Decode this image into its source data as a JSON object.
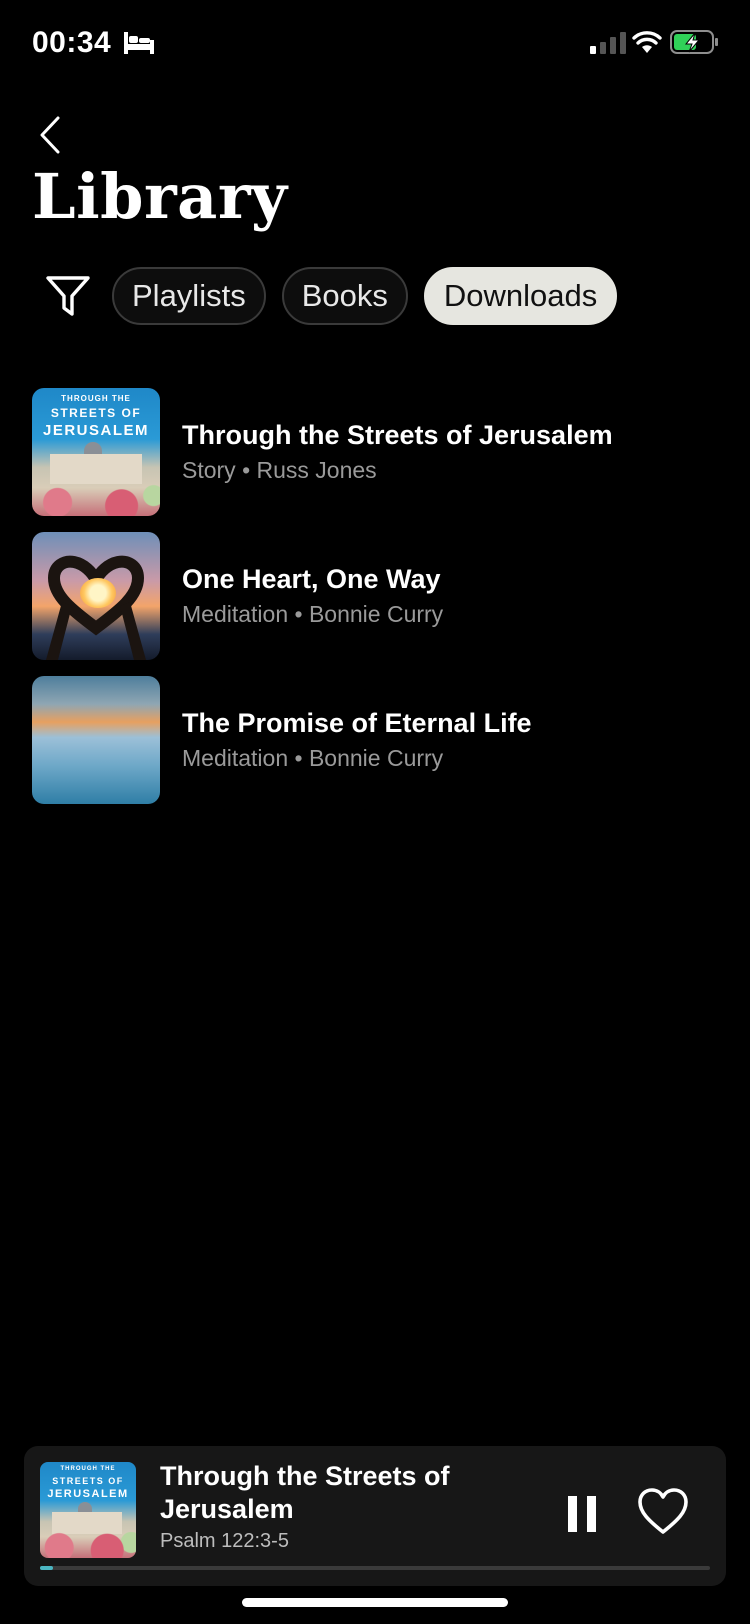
{
  "status_bar": {
    "time": "00:34",
    "icons": [
      "bed-icon",
      "signal-icon",
      "wifi-icon",
      "battery-charging-icon"
    ],
    "battery_color": "#30d158"
  },
  "header": {
    "title": "Library"
  },
  "filters": {
    "icon": "filter-icon",
    "chips": [
      {
        "label": "Playlists",
        "active": false
      },
      {
        "label": "Books",
        "active": false
      },
      {
        "label": "Downloads",
        "active": true
      }
    ]
  },
  "downloads": [
    {
      "title": "Through the Streets of Jerusalem",
      "meta": "Story • Russ Jones",
      "cover_text": [
        "THROUGH THE",
        "STREETS OF",
        "JERUSALEM"
      ]
    },
    {
      "title": "One Heart, One Way",
      "meta": "Meditation • Bonnie Curry"
    },
    {
      "title": "The Promise of Eternal Life",
      "meta": "Meditation • Bonnie Curry"
    }
  ],
  "player": {
    "title": "Through the Streets of Jerusalem",
    "subtitle": "Psalm 122:3-5",
    "cover_text": [
      "THROUGH THE",
      "STREETS OF",
      "JERUSALEM"
    ],
    "progress": 0.02,
    "progress_color": "#4bb6c2",
    "icons": [
      "pause-icon",
      "heart-outline-icon"
    ]
  }
}
